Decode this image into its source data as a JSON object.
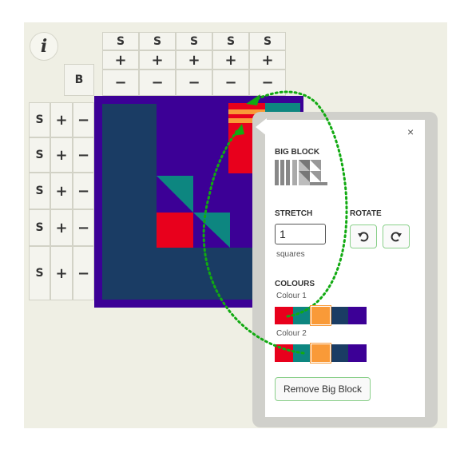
{
  "info_label": "i",
  "corner_label": "B",
  "column_controls": {
    "s": "S",
    "plus": "+",
    "minus": "−"
  },
  "row_controls": {
    "s": "S",
    "plus": "+",
    "minus": "−"
  },
  "palette": [
    "#e8001c",
    "#0d8680",
    "#f99a38",
    "#1a3c64",
    "#3c0096"
  ],
  "panel": {
    "close": "×",
    "big_block_heading": "BIG BLOCK",
    "stretch_heading": "STRETCH",
    "rotate_heading": "ROTATE",
    "stretch_value": "1",
    "stretch_unit": "squares",
    "colours_heading": "COLOURS",
    "colour1_label": "Colour 1",
    "colour2_label": "Colour 2",
    "colour1_selected": 2,
    "colour2_selected": 2,
    "remove_button": "Remove Big Block",
    "rotate_ccw_icon": "rotate-counterclockwise-icon",
    "rotate_cw_icon": "rotate-clockwise-icon",
    "big_block_icon": "big-block-pattern-icon"
  }
}
